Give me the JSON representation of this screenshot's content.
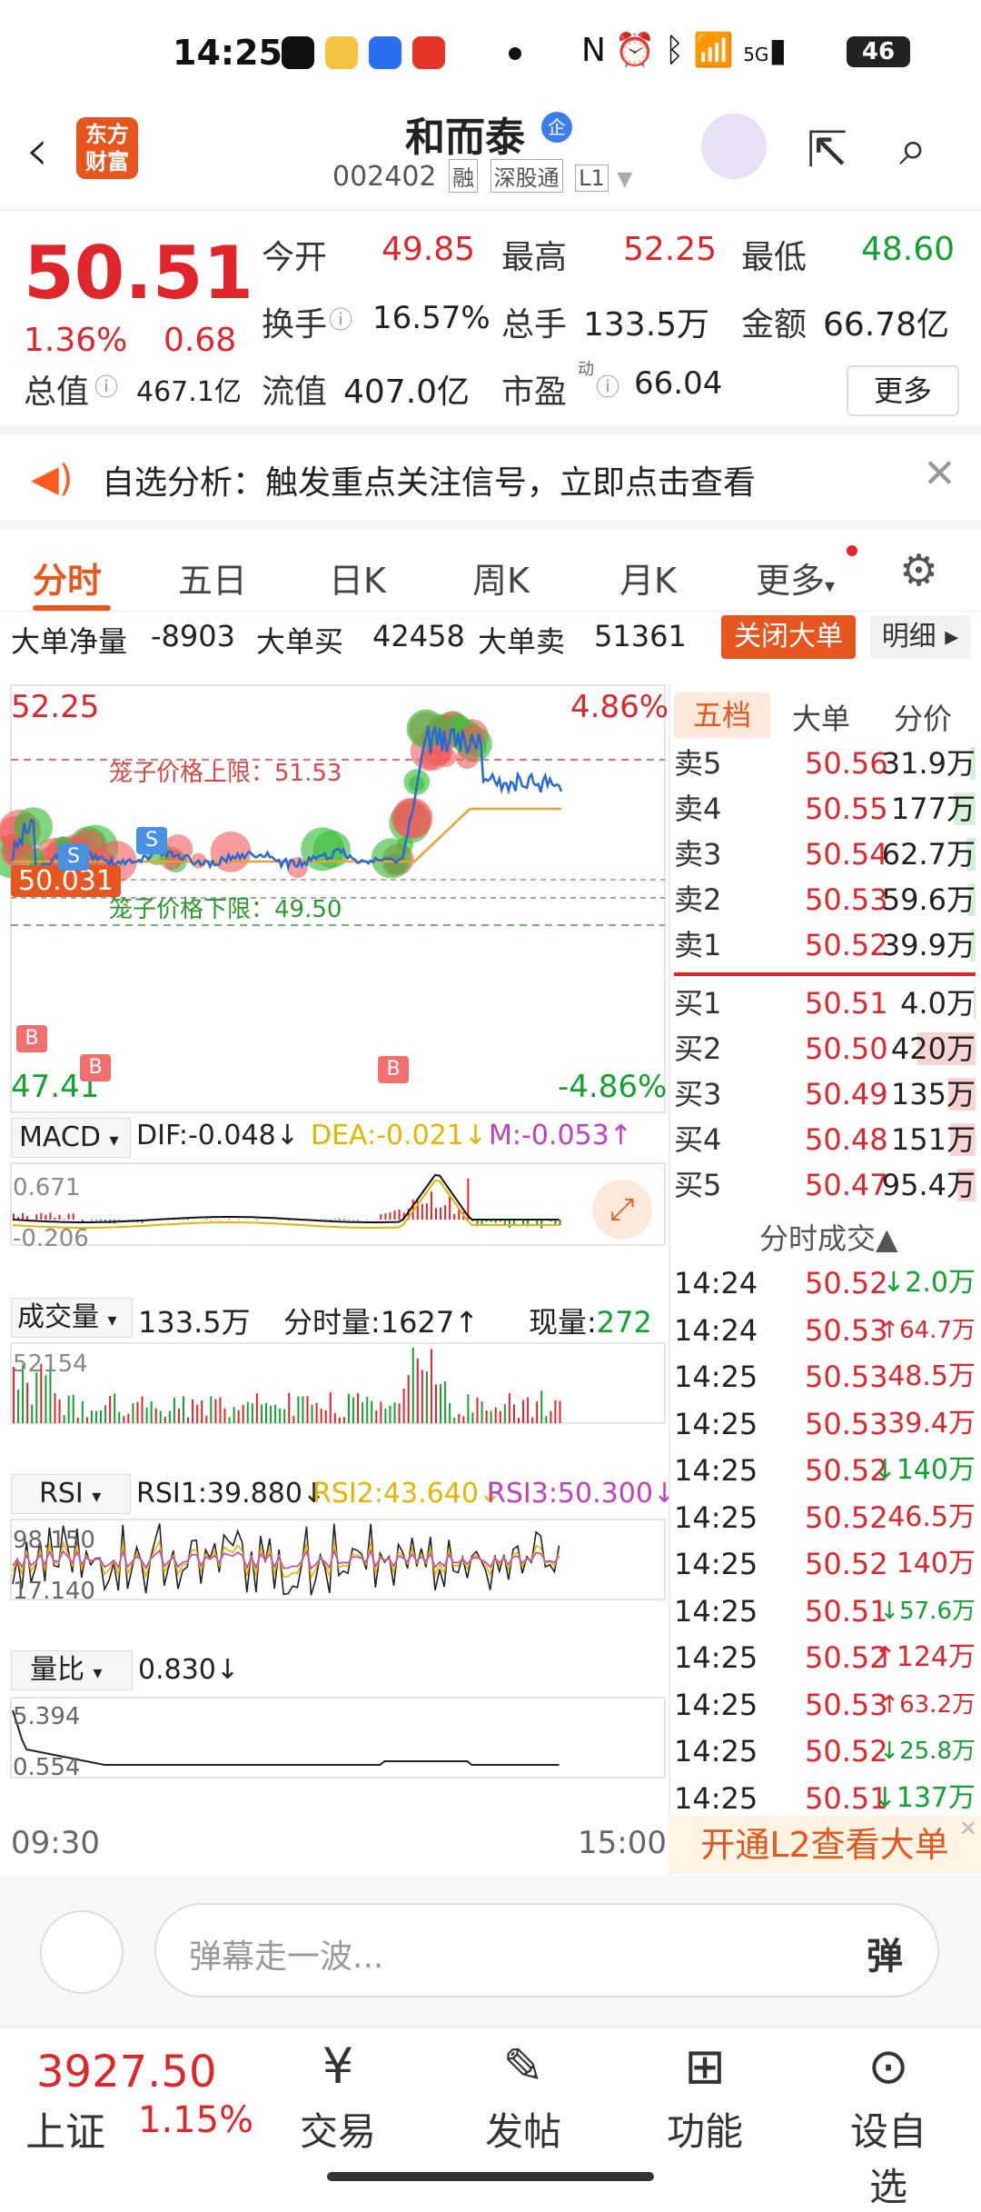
{
  "status": {
    "time": "14:25",
    "battery": "46",
    "signal": "5G"
  },
  "header": {
    "logo": "东方财富",
    "name": "和而泰",
    "badge": "企",
    "code": "002402",
    "tags": [
      "融",
      "深股通",
      "L1"
    ]
  },
  "quote": {
    "price": "50.51",
    "pct": "1.36%",
    "change": "0.68",
    "open_label": "今开",
    "open": "49.85",
    "high_label": "最高",
    "high": "52.25",
    "low_label": "最低",
    "low": "48.60",
    "turnover_label": "换手",
    "turnover": "16.57%",
    "vol_label": "总手",
    "vol": "133.5万",
    "amt_label": "金额",
    "amt": "66.78亿",
    "mcap_label": "总值",
    "mcap": "467.1亿",
    "float_label": "流值",
    "float": "407.0亿",
    "pe_label": "市盈",
    "pe_sup": "动",
    "pe": "66.04",
    "more": "更多"
  },
  "notice": {
    "text": "自选分析：触发重点关注信号，立即点击查看"
  },
  "tabs": [
    "分时",
    "五日",
    "日K",
    "周K",
    "月K",
    "更多"
  ],
  "bigorder": {
    "net_label": "大单净量",
    "net": "-8903",
    "buy_label": "大单买",
    "buy": "42458",
    "sell_label": "大单卖",
    "sell": "51361",
    "close_btn": "关闭大单",
    "detail_btn": "明细 ▸"
  },
  "chart": {
    "top_price": "52.25",
    "top_pct": "4.86%",
    "bottom_price": "47.41",
    "bottom_pct": "-4.86%",
    "upper_limit": "笼子价格上限：51.53",
    "lower_limit": "笼子价格下限：49.50",
    "current_tag": "50.031",
    "start_time": "09:30",
    "end_time": "15:00",
    "macd_label": "MACD",
    "macd_dif": "DIF:-0.048↓",
    "macd_dea": "DEA:-0.021↓",
    "macd_m": "M:-0.053↑",
    "macd_top": "0.671",
    "macd_bottom": "-0.206",
    "vol_label": "成交量",
    "vol_total": "133.5万",
    "vol_fen": "分时量:1627↑",
    "vol_now_label": "现量:",
    "vol_now": "272",
    "vol_max": "52154",
    "rsi_label": "RSI",
    "rsi1": "RSI1:39.880↓",
    "rsi2": "RSI2:43.640↓",
    "rsi3": "RSI3:50.300↓",
    "rsi_top": "98.150",
    "rsi_bottom": "17.140",
    "lb_label": "量比",
    "lb_val": "0.830↓",
    "lb_top": "5.394",
    "lb_bottom": "0.554"
  },
  "orderbook": {
    "tabs": [
      "五档",
      "大单",
      "分价"
    ],
    "sell": [
      {
        "l": "卖5",
        "p": "50.56",
        "v": "31.9万"
      },
      {
        "l": "卖4",
        "p": "50.55",
        "v": "177万"
      },
      {
        "l": "卖3",
        "p": "50.54",
        "v": "62.7万"
      },
      {
        "l": "卖2",
        "p": "50.53",
        "v": "59.6万"
      },
      {
        "l": "卖1",
        "p": "50.52",
        "v": "39.9万"
      }
    ],
    "buy": [
      {
        "l": "买1",
        "p": "50.51",
        "v": "4.0万"
      },
      {
        "l": "买2",
        "p": "50.50",
        "v": "420万"
      },
      {
        "l": "买3",
        "p": "50.49",
        "v": "135万"
      },
      {
        "l": "买4",
        "p": "50.48",
        "v": "151万"
      },
      {
        "l": "买5",
        "p": "50.47",
        "v": "95.4万"
      }
    ]
  },
  "ticks": {
    "title": "分时成交",
    "rows": [
      {
        "t": "14:24",
        "p": "50.52",
        "v": "↓2.0万",
        "c": "green"
      },
      {
        "t": "14:24",
        "p": "50.53",
        "v": "↑64.7万",
        "c": "red"
      },
      {
        "t": "14:25",
        "p": "50.53",
        "v": "48.5万",
        "c": "red"
      },
      {
        "t": "14:25",
        "p": "50.53",
        "v": "39.4万",
        "c": "red"
      },
      {
        "t": "14:25",
        "p": "50.52",
        "v": "↓140万",
        "c": "green"
      },
      {
        "t": "14:25",
        "p": "50.52",
        "v": "46.5万",
        "c": "red"
      },
      {
        "t": "14:25",
        "p": "50.52",
        "v": "140万",
        "c": "red"
      },
      {
        "t": "14:25",
        "p": "50.51",
        "v": "↓57.6万",
        "c": "green"
      },
      {
        "t": "14:25",
        "p": "50.52",
        "v": "↑124万",
        "c": "red"
      },
      {
        "t": "14:25",
        "p": "50.53",
        "v": "↑63.2万",
        "c": "red"
      },
      {
        "t": "14:25",
        "p": "50.52",
        "v": "↓25.8万",
        "c": "green"
      },
      {
        "t": "14:25",
        "p": "50.51",
        "v": "↓137万",
        "c": "green"
      }
    ]
  },
  "l2_text": "开通L2查看大单",
  "danmu": {
    "placeholder": "弹幕走一波...",
    "btn": "弹"
  },
  "bottom": {
    "index_val": "3927.50",
    "index_name": "上证",
    "index_pct": "1.15%",
    "nav": [
      "交易",
      "发帖",
      "功能",
      "设自选"
    ]
  },
  "colors": {
    "accent": "#e8561f",
    "up": "#e0262b",
    "down": "#12a32f"
  }
}
